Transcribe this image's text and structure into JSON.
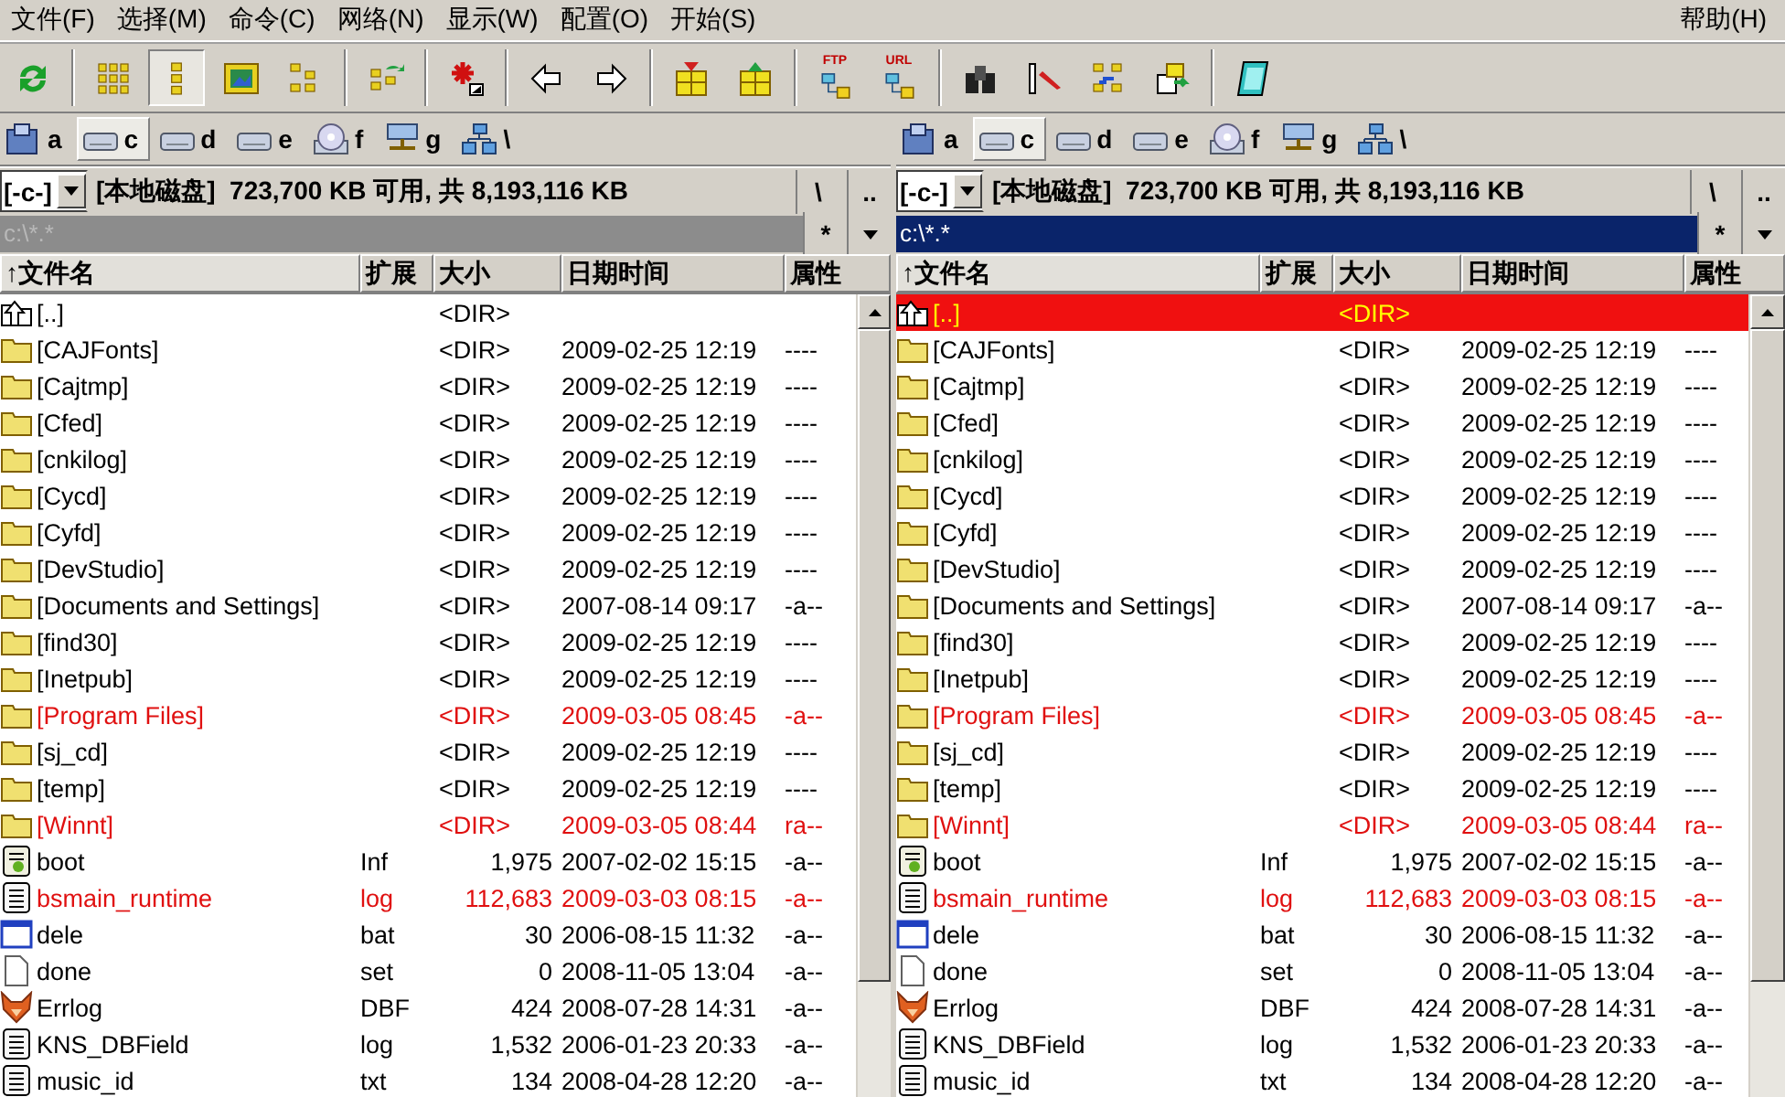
{
  "menu": [
    {
      "label": "文件(F)"
    },
    {
      "label": "选择(M)"
    },
    {
      "label": "命令(C)"
    },
    {
      "label": "网络(N)"
    },
    {
      "label": "显示(W)"
    },
    {
      "label": "配置(O)"
    },
    {
      "label": "开始(S)"
    }
  ],
  "help_menu": "帮助(H)",
  "toolbar": [
    {
      "buttons": [
        {
          "kind": "refresh",
          "selected": false
        }
      ]
    },
    {
      "buttons": [
        {
          "kind": "brief",
          "selected": false
        },
        {
          "kind": "detail",
          "selected": true
        },
        {
          "kind": "thumbs",
          "selected": false
        },
        {
          "kind": "tree",
          "selected": false
        }
      ]
    },
    {
      "buttons": [
        {
          "kind": "swap",
          "selected": false
        }
      ]
    },
    {
      "buttons": [
        {
          "kind": "star",
          "selected": false
        }
      ]
    },
    {
      "buttons": [
        {
          "kind": "back",
          "selected": false
        },
        {
          "kind": "forward",
          "selected": false
        }
      ]
    },
    {
      "buttons": [
        {
          "kind": "pack",
          "selected": false
        },
        {
          "kind": "unpack",
          "selected": false
        }
      ]
    },
    {
      "buttons": [
        {
          "kind": "ftp",
          "label": "FTP",
          "selected": false
        },
        {
          "kind": "url",
          "label": "URL",
          "selected": false
        }
      ]
    },
    {
      "buttons": [
        {
          "kind": "search",
          "selected": false
        },
        {
          "kind": "rename",
          "selected": false
        },
        {
          "kind": "sync",
          "selected": false
        },
        {
          "kind": "copy",
          "selected": false
        }
      ]
    },
    {
      "buttons": [
        {
          "kind": "notepad",
          "selected": false
        }
      ]
    }
  ],
  "panels": [
    {
      "active": false,
      "drives": [
        {
          "letter": "a",
          "kind": "floppy",
          "selected": false
        },
        {
          "letter": "c",
          "kind": "disk",
          "selected": true
        },
        {
          "letter": "d",
          "kind": "disk",
          "selected": false
        },
        {
          "letter": "e",
          "kind": "disk",
          "selected": false
        },
        {
          "letter": "f",
          "kind": "cdrom",
          "selected": false
        },
        {
          "letter": "g",
          "kind": "network",
          "selected": false
        },
        {
          "letter": "\\",
          "kind": "netroot",
          "selected": false
        }
      ],
      "drive_combo": "[-c-]",
      "disk_info": "[本地磁盘]  723,700 KB 可用, 共 8,193,116 KB",
      "root_button": "\\",
      "up_button": "..",
      "path": "c:\\*.*",
      "filter_button": "*",
      "columns": [
        "↑文件名",
        "扩展",
        "大小",
        "日期时间",
        "属性"
      ],
      "rows": [
        {
          "kind": "up",
          "name": "[..]",
          "size": "<DIR>",
          "date": "",
          "attr": "",
          "color": "#000000",
          "selected": false
        },
        {
          "kind": "folder",
          "name": "[CAJFonts]",
          "size": "<DIR>",
          "date": "2009-02-25 12:19",
          "attr": "----",
          "color": "#000000",
          "selected": false
        },
        {
          "kind": "folder",
          "name": "[Cajtmp]",
          "size": "<DIR>",
          "date": "2009-02-25 12:19",
          "attr": "----",
          "color": "#000000",
          "selected": false
        },
        {
          "kind": "folder",
          "name": "[Cfed]",
          "size": "<DIR>",
          "date": "2009-02-25 12:19",
          "attr": "----",
          "color": "#000000",
          "selected": false
        },
        {
          "kind": "folder",
          "name": "[cnkilog]",
          "size": "<DIR>",
          "date": "2009-02-25 12:19",
          "attr": "----",
          "color": "#000000",
          "selected": false
        },
        {
          "kind": "folder",
          "name": "[Cycd]",
          "size": "<DIR>",
          "date": "2009-02-25 12:19",
          "attr": "----",
          "color": "#000000",
          "selected": false
        },
        {
          "kind": "folder",
          "name": "[Cyfd]",
          "size": "<DIR>",
          "date": "2009-02-25 12:19",
          "attr": "----",
          "color": "#000000",
          "selected": false
        },
        {
          "kind": "folder",
          "name": "[DevStudio]",
          "size": "<DIR>",
          "date": "2009-02-25 12:19",
          "attr": "----",
          "color": "#000000",
          "selected": false
        },
        {
          "kind": "folder",
          "name": "[Documents and Settings]",
          "size": "<DIR>",
          "date": "2007-08-14 09:17",
          "attr": "-a--",
          "color": "#000000",
          "selected": false
        },
        {
          "kind": "folder",
          "name": "[find30]",
          "size": "<DIR>",
          "date": "2009-02-25 12:19",
          "attr": "----",
          "color": "#000000",
          "selected": false
        },
        {
          "kind": "folder",
          "name": "[Inetpub]",
          "size": "<DIR>",
          "date": "2009-02-25 12:19",
          "attr": "----",
          "color": "#000000",
          "selected": false
        },
        {
          "kind": "folder",
          "name": "[Program Files]",
          "size": "<DIR>",
          "date": "2009-03-05 08:45",
          "attr": "-a--",
          "color": "#e01010",
          "selected": false
        },
        {
          "kind": "folder",
          "name": "[sj_cd]",
          "size": "<DIR>",
          "date": "2009-02-25 12:19",
          "attr": "----",
          "color": "#000000",
          "selected": false
        },
        {
          "kind": "folder",
          "name": "[temp]",
          "size": "<DIR>",
          "date": "2009-02-25 12:19",
          "attr": "----",
          "color": "#000000",
          "selected": false
        },
        {
          "kind": "folder",
          "name": "[Winnt]",
          "size": "<DIR>",
          "date": "2009-03-05 08:44",
          "attr": "ra--",
          "color": "#e01010",
          "selected": false
        },
        {
          "kind": "config",
          "name": "boot",
          "ext": "Inf",
          "size": "1,975",
          "date": "2007-02-02 15:15",
          "attr": "-a--",
          "color": "#000000",
          "selected": false
        },
        {
          "kind": "text",
          "name": "bsmain_runtime",
          "ext": "log",
          "size": "112,683",
          "date": "2009-03-03 08:15",
          "attr": "-a--",
          "color": "#e01010",
          "selected": false
        },
        {
          "kind": "window",
          "name": "dele",
          "ext": "bat",
          "size": "30",
          "date": "2006-08-15 11:32",
          "attr": "-a--",
          "color": "#000000",
          "selected": false
        },
        {
          "kind": "blank",
          "name": "done",
          "ext": "set",
          "size": "0",
          "date": "2008-11-05 13:04",
          "attr": "-a--",
          "color": "#000000",
          "selected": false
        },
        {
          "kind": "fox",
          "name": "Errlog",
          "ext": "DBF",
          "size": "424",
          "date": "2008-07-28 14:31",
          "attr": "-a--",
          "color": "#000000",
          "selected": false
        },
        {
          "kind": "text",
          "name": "KNS_DBField",
          "ext": "log",
          "size": "1,532",
          "date": "2006-01-23 20:33",
          "attr": "-a--",
          "color": "#000000",
          "selected": false
        },
        {
          "kind": "text",
          "name": "music_id",
          "ext": "txt",
          "size": "134",
          "date": "2008-04-28 12:20",
          "attr": "-a--",
          "color": "#000000",
          "selected": false
        }
      ]
    },
    {
      "active": true,
      "drives": [
        {
          "letter": "a",
          "kind": "floppy",
          "selected": false
        },
        {
          "letter": "c",
          "kind": "disk",
          "selected": true
        },
        {
          "letter": "d",
          "kind": "disk",
          "selected": false
        },
        {
          "letter": "e",
          "kind": "disk",
          "selected": false
        },
        {
          "letter": "f",
          "kind": "cdrom",
          "selected": false
        },
        {
          "letter": "g",
          "kind": "network",
          "selected": false
        },
        {
          "letter": "\\",
          "kind": "netroot",
          "selected": false
        }
      ],
      "drive_combo": "[-c-]",
      "disk_info": "[本地磁盘]  723,700 KB 可用, 共 8,193,116 KB",
      "root_button": "\\",
      "up_button": "..",
      "path": "c:\\*.*",
      "filter_button": "*",
      "columns": [
        "↑文件名",
        "扩展",
        "大小",
        "日期时间",
        "属性"
      ],
      "rows": [
        {
          "kind": "up",
          "name": "[..]",
          "size": "<DIR>",
          "date": "",
          "attr": "",
          "selected": true
        },
        {
          "kind": "folder",
          "name": "[CAJFonts]",
          "size": "<DIR>",
          "date": "2009-02-25 12:19",
          "attr": "----",
          "color": "#000000",
          "selected": false
        },
        {
          "kind": "folder",
          "name": "[Cajtmp]",
          "size": "<DIR>",
          "date": "2009-02-25 12:19",
          "attr": "----",
          "color": "#000000",
          "selected": false
        },
        {
          "kind": "folder",
          "name": "[Cfed]",
          "size": "<DIR>",
          "date": "2009-02-25 12:19",
          "attr": "----",
          "color": "#000000",
          "selected": false
        },
        {
          "kind": "folder",
          "name": "[cnkilog]",
          "size": "<DIR>",
          "date": "2009-02-25 12:19",
          "attr": "----",
          "color": "#000000",
          "selected": false
        },
        {
          "kind": "folder",
          "name": "[Cycd]",
          "size": "<DIR>",
          "date": "2009-02-25 12:19",
          "attr": "----",
          "color": "#000000",
          "selected": false
        },
        {
          "kind": "folder",
          "name": "[Cyfd]",
          "size": "<DIR>",
          "date": "2009-02-25 12:19",
          "attr": "----",
          "color": "#000000",
          "selected": false
        },
        {
          "kind": "folder",
          "name": "[DevStudio]",
          "size": "<DIR>",
          "date": "2009-02-25 12:19",
          "attr": "----",
          "color": "#000000",
          "selected": false
        },
        {
          "kind": "folder",
          "name": "[Documents and Settings]",
          "size": "<DIR>",
          "date": "2007-08-14 09:17",
          "attr": "-a--",
          "color": "#000000",
          "selected": false
        },
        {
          "kind": "folder",
          "name": "[find30]",
          "size": "<DIR>",
          "date": "2009-02-25 12:19",
          "attr": "----",
          "color": "#000000",
          "selected": false
        },
        {
          "kind": "folder",
          "name": "[Inetpub]",
          "size": "<DIR>",
          "date": "2009-02-25 12:19",
          "attr": "----",
          "color": "#000000",
          "selected": false
        },
        {
          "kind": "folder",
          "name": "[Program Files]",
          "size": "<DIR>",
          "date": "2009-03-05 08:45",
          "attr": "-a--",
          "color": "#e01010",
          "selected": false
        },
        {
          "kind": "folder",
          "name": "[sj_cd]",
          "size": "<DIR>",
          "date": "2009-02-25 12:19",
          "attr": "----",
          "color": "#000000",
          "selected": false
        },
        {
          "kind": "folder",
          "name": "[temp]",
          "size": "<DIR>",
          "date": "2009-02-25 12:19",
          "attr": "----",
          "color": "#000000",
          "selected": false
        },
        {
          "kind": "folder",
          "name": "[Winnt]",
          "size": "<DIR>",
          "date": "2009-03-05 08:44",
          "attr": "ra--",
          "color": "#e01010",
          "selected": false
        },
        {
          "kind": "config",
          "name": "boot",
          "ext": "Inf",
          "size": "1,975",
          "date": "2007-02-02 15:15",
          "attr": "-a--",
          "color": "#000000",
          "selected": false
        },
        {
          "kind": "text",
          "name": "bsmain_runtime",
          "ext": "log",
          "size": "112,683",
          "date": "2009-03-03 08:15",
          "attr": "-a--",
          "color": "#e01010",
          "selected": false
        },
        {
          "kind": "window",
          "name": "dele",
          "ext": "bat",
          "size": "30",
          "date": "2006-08-15 11:32",
          "attr": "-a--",
          "color": "#000000",
          "selected": false
        },
        {
          "kind": "blank",
          "name": "done",
          "ext": "set",
          "size": "0",
          "date": "2008-11-05 13:04",
          "attr": "-a--",
          "color": "#000000",
          "selected": false
        },
        {
          "kind": "fox",
          "name": "Errlog",
          "ext": "DBF",
          "size": "424",
          "date": "2008-07-28 14:31",
          "attr": "-a--",
          "color": "#000000",
          "selected": false
        },
        {
          "kind": "text",
          "name": "KNS_DBField",
          "ext": "log",
          "size": "1,532",
          "date": "2006-01-23 20:33",
          "attr": "-a--",
          "color": "#000000",
          "selected": false
        },
        {
          "kind": "text",
          "name": "music_id",
          "ext": "txt",
          "size": "134",
          "date": "2008-04-28 12:20",
          "attr": "-a--",
          "color": "#000000",
          "selected": false
        }
      ]
    }
  ]
}
